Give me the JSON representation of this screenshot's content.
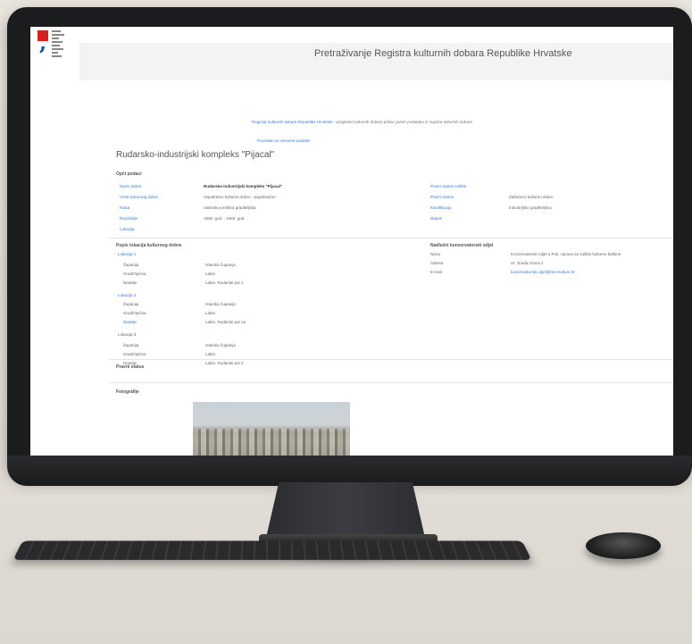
{
  "header": {
    "title": "Pretraživanje Registra kulturnih dobara Republike Hrvatske"
  },
  "notice": {
    "link_text": "Registar kulturnih dobara Republike Hrvatske",
    "text": " - pregledni kulturnih dobara prikaz javnih podataka iz registra kulturnih dobara"
  },
  "sub_link": "Povratak na osnovne podatke",
  "page_title": "Rudarsko-industrijski kompleks \"Pijacal\"",
  "sections": {
    "basic": "Opći podaci",
    "locations": "Popis lokacija kulturnog dobra",
    "info_center": "Nadležni konzervatorski odjel",
    "protection": "Pravni status",
    "photos": "Fotografije"
  },
  "basic_left": [
    {
      "label": "Naziv dobra",
      "value": "Rudarsko-industrijski kompleks \"Pijacal\""
    },
    {
      "label": "Vrsta kulturnog dobra",
      "value": "nepokretno kulturno dobro - pojedinačno"
    },
    {
      "label": "Klasa",
      "value": "Sakralno-profana graditeljska"
    },
    {
      "label": "Razdoblje",
      "value": "1836. god. - 1960. god."
    },
    {
      "label": "Lokacija",
      "value": ""
    }
  ],
  "basic_right": [
    {
      "label": "Pravni status zaštite",
      "value": ""
    },
    {
      "label": "Pravni status",
      "value": "Zaštićeno kulturno dobro"
    },
    {
      "label": "Klasifikacija",
      "value": "Industrijsko graditeljstvo"
    },
    {
      "label": "Datum",
      "value": ""
    }
  ],
  "locations": [
    {
      "name": "Lokacija 1",
      "rows": [
        {
          "label": "Županija",
          "value": "Istarska županija"
        },
        {
          "label": "Grad/Općina",
          "value": "Labin"
        },
        {
          "label": "Naselje",
          "value": "Labin, Rudarski put 1"
        }
      ]
    },
    {
      "name": "Lokacija 2",
      "rows": [
        {
          "label": "Županija",
          "value": "Istarska županija"
        },
        {
          "label": "Grad/Općina",
          "value": "Labin"
        },
        {
          "label": "Naselje",
          "value": "Labin, Rudarski put 1a"
        }
      ]
    },
    {
      "name": "Lokacija 3",
      "rows": [
        {
          "label": "Županija",
          "value": "Istarska županija"
        },
        {
          "label": "Grad/Općina",
          "value": "Labin"
        },
        {
          "label": "Naselje",
          "value": "Labin, Rudarski put 3"
        }
      ]
    }
  ],
  "info_center": [
    {
      "label": "Naziv",
      "value": "Konzervatorski odjel u Puli, Uprava za zaštitu kulturne baštine"
    },
    {
      "label": "Adresa",
      "value": "Ul. Grada Graza 2"
    },
    {
      "label": "E-mail",
      "value": "konzervatorski.odjel@min-kulture.hr"
    }
  ]
}
